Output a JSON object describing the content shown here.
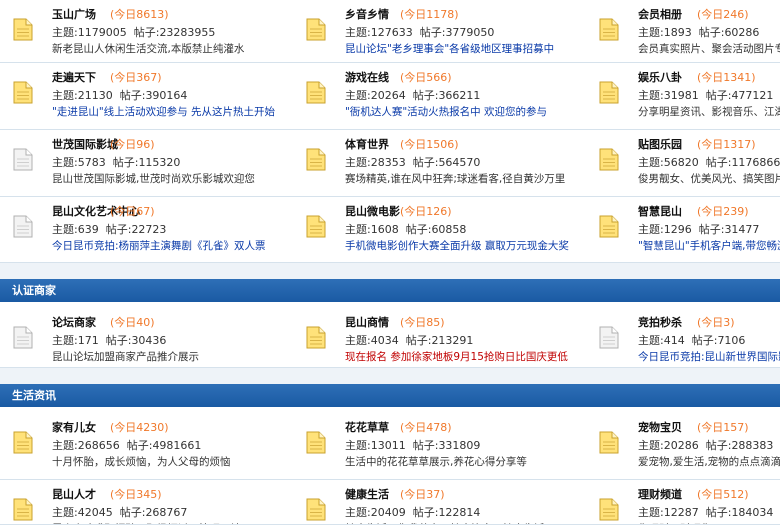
{
  "labels": {
    "topics": "主题:",
    "posts": "帖子:"
  },
  "colors": {
    "section_header": "#1f5fa8",
    "today_count": "#f0782a",
    "link_blue": "#0a3aa8",
    "link_red": "#c00000"
  },
  "sections": [
    {
      "title": "",
      "rows": [
        [
          {
            "name": "玉山广场",
            "today": "(今日8613)",
            "topics": "1179005",
            "posts": "23283955",
            "desc": "新老昆山人休闲生活交流,本版禁止纯灌水",
            "desc_style": "plain",
            "icon": "folder-new-icon"
          },
          {
            "name": "乡音乡情",
            "today": "(今日1178)",
            "topics": "127633",
            "posts": "3779050",
            "desc": "昆山论坛\"老乡理事会\"各省级地区理事招募中",
            "desc_style": "blue",
            "icon": "folder-new-icon"
          },
          {
            "name": "会员相册",
            "today": "(今日246)",
            "topics": "1893",
            "posts": "60286",
            "desc": "会员真实照片、聚会活动图片专区",
            "desc_style": "plain",
            "icon": "folder-new-icon"
          }
        ],
        [
          {
            "name": "走遍天下",
            "today": "(今日367)",
            "topics": "21130",
            "posts": "390164",
            "desc": "\"走进昆山\"线上活动欢迎参与 先从这片热土开始",
            "desc_style": "blue",
            "icon": "folder-new-icon"
          },
          {
            "name": "游戏在线",
            "today": "(今日566)",
            "topics": "20264",
            "posts": "366211",
            "desc": "\"衙机达人赛\"活动火热报名中 欢迎您的参与",
            "desc_style": "blue",
            "icon": "folder-new-icon"
          },
          {
            "name": "娱乐八卦",
            "today": "(今日1341)",
            "topics": "31981",
            "posts": "477121",
            "desc": "分享明星资讯、影视音乐、江湖八卦",
            "desc_style": "plain",
            "icon": "folder-new-icon"
          }
        ],
        [
          {
            "name": "世茂国际影城",
            "today": "(今日96)",
            "topics": "5783",
            "posts": "115320",
            "desc": "昆山世茂国际影城,世茂时尚欢乐影城欢迎您",
            "desc_style": "plain",
            "icon": "folder-old-icon"
          },
          {
            "name": "体育世界",
            "today": "(今日1506)",
            "topics": "28353",
            "posts": "564570",
            "desc": "赛场精英,谁在风中狂奔;球迷看客,径自黄沙万里",
            "desc_style": "plain",
            "icon": "folder-new-icon"
          },
          {
            "name": "贴图乐园",
            "today": "(今日1317)",
            "topics": "56820",
            "posts": "1176866",
            "desc": "俊男靓女、优美风光、搞笑图片",
            "desc_style": "plain",
            "icon": "folder-new-icon"
          }
        ],
        [
          {
            "name": "昆山文化艺术中心",
            "today": "(今日67)",
            "topics": "639",
            "posts": "22723",
            "desc": "今日昆币竞拍:杨丽萍主演舞剧《孔雀》双人票",
            "desc_style": "blue",
            "icon": "folder-old-icon"
          },
          {
            "name": "昆山微电影",
            "today": "(今日126)",
            "topics": "1608",
            "posts": "60858",
            "desc": "手机微电影创作大赛全面升级 赢取万元现金大奖",
            "desc_style": "blue",
            "icon": "folder-new-icon"
          },
          {
            "name": "智慧昆山",
            "today": "(今日239)",
            "topics": "1296",
            "posts": "31477",
            "desc": "\"智慧昆山\"手机客户端,带您畅游昆山",
            "desc_style": "blue",
            "icon": "folder-new-icon"
          }
        ]
      ]
    },
    {
      "title": "认证商家",
      "rows": [
        [
          {
            "name": "论坛商家",
            "today": "(今日40)",
            "topics": "171",
            "posts": "30436",
            "desc": "昆山论坛加盟商家产品推介展示",
            "desc_style": "plain",
            "icon": "folder-old-icon"
          },
          {
            "name": "昆山商情",
            "today": "(今日85)",
            "topics": "4034",
            "posts": "213291",
            "desc": "现在报名 参加徐家地板9月15抢购日比国庆更低",
            "desc_style": "red",
            "icon": "folder-new-icon"
          },
          {
            "name": "竞拍秒杀",
            "today": "(今日3)",
            "topics": "414",
            "posts": "7106",
            "desc": "今日昆币竞拍:昆山新世界国际影城电影票",
            "desc_style": "blue",
            "icon": "folder-old-icon"
          }
        ]
      ]
    },
    {
      "title": "生活资讯",
      "rows": [
        [
          {
            "name": "家有儿女",
            "today": "(今日4230)",
            "topics": "268656",
            "posts": "4981661",
            "desc": "十月怀胎，成长烦恼，为人父母的烦恼",
            "desc_style": "plain",
            "icon": "folder-new-icon"
          },
          {
            "name": "花花草草",
            "today": "(今日478)",
            "topics": "13011",
            "posts": "331809",
            "desc": "生活中的花花草草展示,养花心得分享等",
            "desc_style": "plain",
            "icon": "folder-new-icon"
          },
          {
            "name": "宠物宝贝",
            "today": "(今日157)",
            "topics": "20286",
            "posts": "288383",
            "desc": "爱宠物,爱生活,宠物的点点滴滴",
            "desc_style": "plain",
            "icon": "folder-new-icon"
          }
        ],
        [
          {
            "name": "昆山人才",
            "today": "(今日345)",
            "topics": "42045",
            "posts": "268767",
            "desc": "昆山人才求职招聘、职场探讨、管理天地",
            "desc_style": "plain",
            "icon": "folder-new-icon"
          },
          {
            "name": "健康生活",
            "today": "(今日37)",
            "topics": "20409",
            "posts": "122814",
            "desc": "健康生活，你我共享，健康饮食，健康生活",
            "desc_style": "plain",
            "icon": "folder-new-icon"
          },
          {
            "name": "理财频道",
            "today": "(今日512)",
            "topics": "12287",
            "posts": "184034",
            "desc": "你理财，财理你",
            "desc_style": "plain",
            "icon": "folder-new-icon"
          }
        ]
      ]
    }
  ]
}
